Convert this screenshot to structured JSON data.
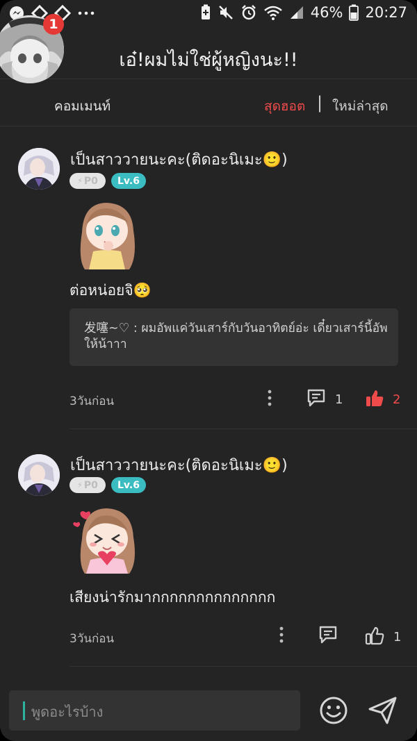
{
  "status_bar": {
    "battery_percent": "46%",
    "time": "20:27"
  },
  "header": {
    "title": "เอ๋!ผมไม่ใช่ผู้หญิงนะ!!",
    "notification_count": "1"
  },
  "tabs": {
    "comment_label": "คอมเมนท์",
    "hot": "สุดฮอต",
    "separator": "|",
    "newest": "ใหม่ล่าสุด"
  },
  "comments": [
    {
      "username": "เป็นสาววายนะคะ(ติดอะนิเมะ🙂)",
      "points_badge": "P0",
      "level_badge": "Lv.6",
      "text": "ต่อหน่อยจิ🥺",
      "reply_author": "发噻~♡",
      "reply_text": " : ผมอัพแค่วันเสาร์กับวันอาทิตย์อ่ะ เดี๋ยวเสาร์นี้อัพให้น้าาา",
      "time": "3วันก่อน",
      "reply_count": "1",
      "like_count": "2",
      "liked": true
    },
    {
      "username": "เป็นสาววายนะคะ(ติดอะนิเมะ🙂)",
      "points_badge": "P0",
      "level_badge": "Lv.6",
      "text": "เสียงน่ารักมากกกกกกกกกกกกกก",
      "time": "3วันก่อน",
      "reply_count": "",
      "like_count": "1",
      "liked": false
    }
  ],
  "input": {
    "placeholder": "พูดอะไรบ้าง"
  },
  "colors": {
    "background": "#242424",
    "accent_red": "#ef4b4b",
    "level_teal": "#3bbcc0",
    "notification_red": "#e53935"
  }
}
